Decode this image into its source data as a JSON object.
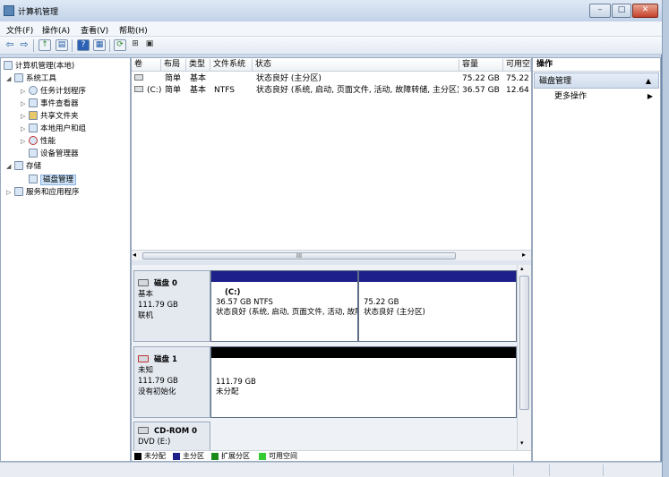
{
  "window": {
    "title": "计算机管理"
  },
  "menu": [
    {
      "label": "文件(F)"
    },
    {
      "label": "操作(A)"
    },
    {
      "label": "查看(V)"
    },
    {
      "label": "帮助(H)"
    }
  ],
  "tree": {
    "items": [
      {
        "label": "计算机管理(本地)",
        "icon": "computer-management-icon"
      },
      {
        "label": "系统工具",
        "icon": "tools-icon"
      },
      {
        "label": "任务计划程序",
        "icon": "clock-icon"
      },
      {
        "label": "事件查看器",
        "icon": "event-viewer-icon"
      },
      {
        "label": "共享文件夹",
        "icon": "shared-folder-icon"
      },
      {
        "label": "本地用户和组",
        "icon": "users-icon"
      },
      {
        "label": "性能",
        "icon": "performance-icon"
      },
      {
        "label": "设备管理器",
        "icon": "device-manager-icon"
      },
      {
        "label": "存储",
        "icon": "storage-icon"
      },
      {
        "label": "磁盘管理",
        "icon": "disk-management-icon"
      },
      {
        "label": "服务和应用程序",
        "icon": "services-icon"
      }
    ]
  },
  "volume_table": {
    "headers": [
      "卷",
      "布局",
      "类型",
      "文件系统",
      "状态",
      "容量",
      "可用空"
    ],
    "rows": [
      [
        "",
        "简单",
        "基本",
        "",
        "状态良好 (主分区)",
        "75.22 GB",
        "75.22"
      ],
      [
        "(C:)",
        "简单",
        "基本",
        "NTFS",
        "状态良好 (系统, 启动, 页面文件, 活动, 故障转储, 主分区)",
        "36.57 GB",
        "12.64"
      ]
    ],
    "scroll_center": "III"
  },
  "disks": [
    {
      "name": "磁盘 0",
      "type": "基本",
      "size": "111.79 GB",
      "status": "联机",
      "partitions": [
        {
          "label": "(C:)",
          "size": "36.57 GB NTFS",
          "status": "状态良好 (系统, 启动, 页面文件, 活动, 故障转储, 主分区)"
        },
        {
          "label": "",
          "size": "75.22 GB",
          "status": "状态良好 (主分区)"
        }
      ]
    },
    {
      "name": "磁盘 1",
      "type": "未知",
      "size": "111.79 GB",
      "status": "没有初始化",
      "partitions": [
        {
          "size": "111.79 GB",
          "status": "未分配"
        }
      ]
    },
    {
      "name": "CD-ROM 0",
      "type": "DVD (E:)"
    }
  ],
  "legend": [
    {
      "label": "未分配",
      "color": "#000000"
    },
    {
      "label": "主分区",
      "color": "#1d1f8a"
    },
    {
      "label": "扩展分区",
      "color": "#1a8a1a"
    },
    {
      "label": "可用空间",
      "color": "#33cc33"
    }
  ],
  "actions": {
    "header": "操作",
    "section": "磁盘管理",
    "more": "更多操作"
  },
  "colors": {
    "primary_partition": "#1d1f8a",
    "unallocated": "#000000"
  }
}
